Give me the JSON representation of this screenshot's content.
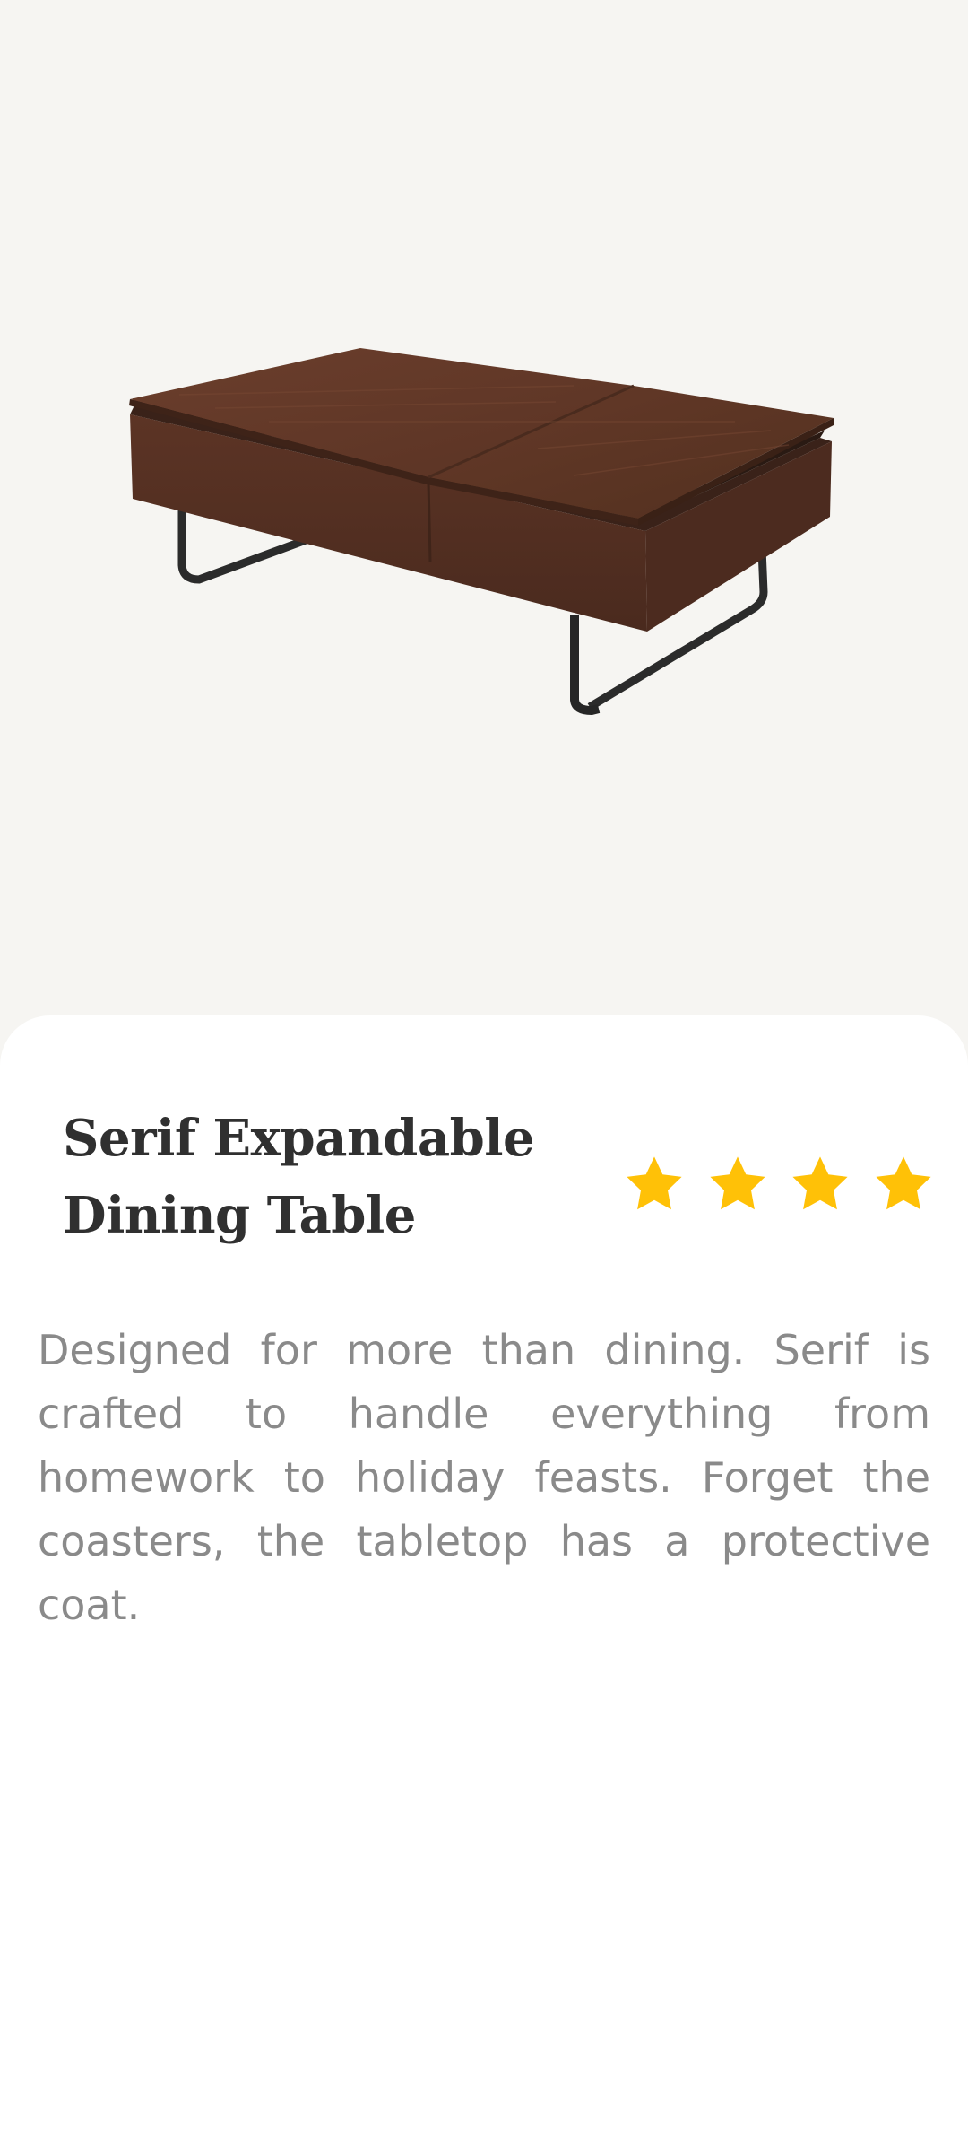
{
  "product": {
    "title": "Serif Expandable Dining Table",
    "rating": 4,
    "description": "Designed for more than dining. Serif is crafted to handle everything from homework to holiday feasts. Forget the coasters, the tabletop has a protective coat."
  },
  "icons": {
    "rating_star": "star-icon"
  },
  "colors": {
    "hero_background": "#f6f5f2",
    "card_background": "#ffffff",
    "title_text": "#303030",
    "description_text": "#8a8a8a",
    "star": "#ffc107"
  }
}
